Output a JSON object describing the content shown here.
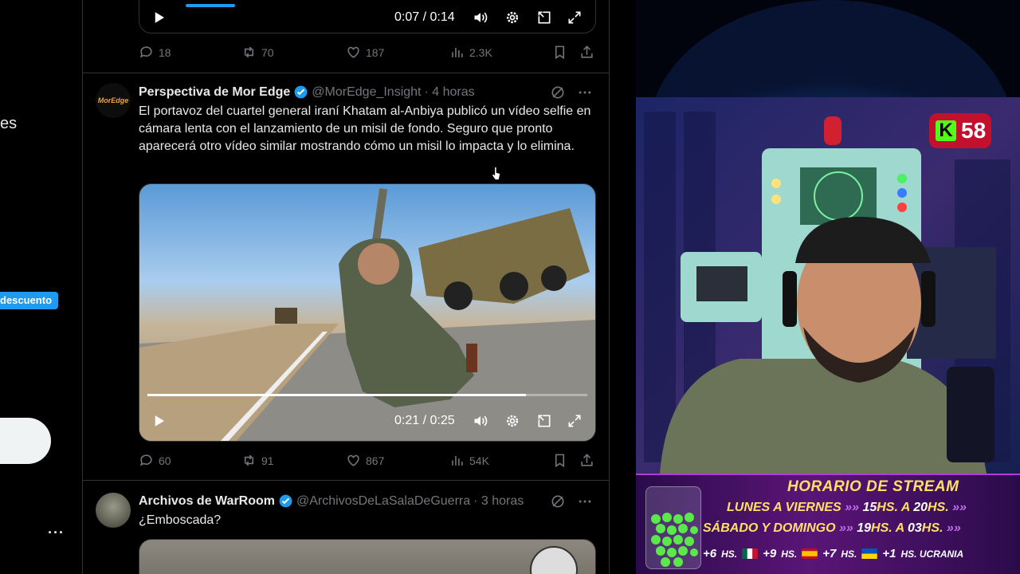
{
  "left_sidebar": {
    "partial_nav_text": "es",
    "discount_label": "descuento",
    "more_label": "···"
  },
  "feed": {
    "top_video": {
      "time": "0:07 / 0:14"
    },
    "top_actions": {
      "replies": "18",
      "reposts": "70",
      "likes": "187",
      "views": "2.3K"
    },
    "post1": {
      "name": "Perspectiva de Mor Edge",
      "handle": "@MorEdge_Insight",
      "time": "· 4 horas",
      "avatar_text": "MorEdge",
      "text": "El portavoz del cuartel general iraní Khatam al-Anbiya publicó un vídeo selfie en cámara lenta con el lanzamiento de un misil de fondo. Seguro que pronto aparecerá otro vídeo similar mostrando cómo un misil lo impacta y lo elimina.",
      "video_time": "0:21 / 0:25",
      "video_progress": 0.86,
      "replies": "60",
      "reposts": "91",
      "likes": "867",
      "views": "54K"
    },
    "post2": {
      "name": "Archivos de WarRoom",
      "handle": "@ArchivosDeLaSalaDeGuerra",
      "time": "· 3 horas",
      "text": "¿Emboscada?"
    }
  },
  "stream": {
    "kick_letter": "K",
    "viewer_count": "58",
    "schedule": {
      "title": "HORARIO DE STREAM",
      "row1_days": "LUNES A VIERNES",
      "row1_time_a": "15",
      "row1_time_b": "20",
      "row2_days": "SÁBADO Y DOMINGO",
      "row2_time_a": "19",
      "row2_time_b": "03",
      "hs": "HS.",
      "a": "A",
      "arrows": "»»",
      "tz1": "+6",
      "tz2": "+9",
      "tz3": "+7",
      "tz4": "+1",
      "tz4_label": "HS. UCRANIA"
    }
  },
  "colors": {
    "accent": "#1d9bf0",
    "kick_green": "#53fc18",
    "kick_red": "#c3102d",
    "schedule_yellow": "#ffe066"
  }
}
